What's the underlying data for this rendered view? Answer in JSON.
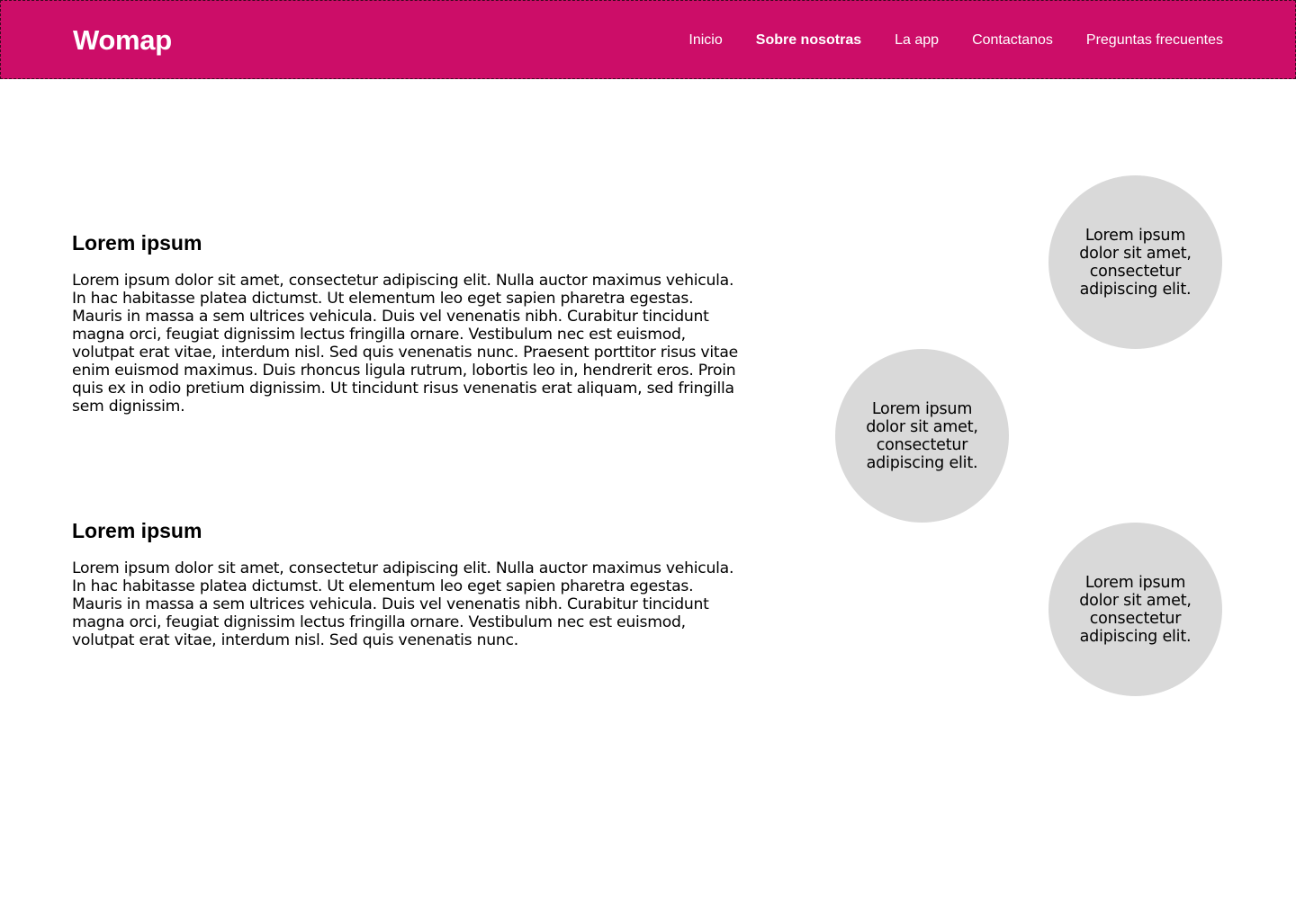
{
  "header": {
    "logo": "Womap",
    "nav": [
      {
        "label": "Inicio",
        "active": false
      },
      {
        "label": "Sobre nosotras",
        "active": true
      },
      {
        "label": "La app",
        "active": false
      },
      {
        "label": "Contactanos",
        "active": false
      },
      {
        "label": "Preguntas frecuentes",
        "active": false
      }
    ]
  },
  "sections": [
    {
      "title": "Lorem ipsum",
      "body": "Lorem ipsum dolor sit amet, consectetur adipiscing elit. Nulla auctor maximus vehicula. In hac habitasse platea dictumst. Ut elementum leo eget sapien pharetra egestas. Mauris in massa a sem ultrices vehicula. Duis vel venenatis nibh. Curabitur tincidunt magna orci, feugiat dignissim lectus fringilla ornare. Vestibulum nec est euismod, volutpat erat vitae, interdum nisl. Sed quis venenatis nunc. Praesent porttitor risus vitae enim euismod maximus. Duis rhoncus ligula rutrum, lobortis leo in, hendrerit eros. Proin quis ex in odio pretium dignissim. Ut tincidunt risus venenatis erat aliquam, sed fringilla sem dignissim."
    },
    {
      "title": "Lorem ipsum",
      "body": "Lorem ipsum dolor sit amet, consectetur adipiscing elit. Nulla auctor maximus vehicula. In hac habitasse platea dictumst. Ut elementum leo eget sapien pharetra egestas. Mauris in massa a sem ultrices vehicula. Duis vel venenatis nibh. Curabitur tincidunt magna orci, feugiat dignissim lectus fringilla ornare. Vestibulum nec est euismod, volutpat erat vitae, interdum nisl. Sed quis venenatis nunc."
    }
  ],
  "circles": [
    {
      "text": "Lorem ipsum dolor sit amet, consectetur adipiscing elit."
    },
    {
      "text": "Lorem ipsum dolor sit amet, consectetur adipiscing elit."
    },
    {
      "text": "Lorem ipsum dolor sit amet, consectetur adipiscing elit."
    }
  ],
  "colors": {
    "header_bg": "#cc0d68",
    "circle_bg": "#d9d9d9",
    "text": "#000000"
  }
}
